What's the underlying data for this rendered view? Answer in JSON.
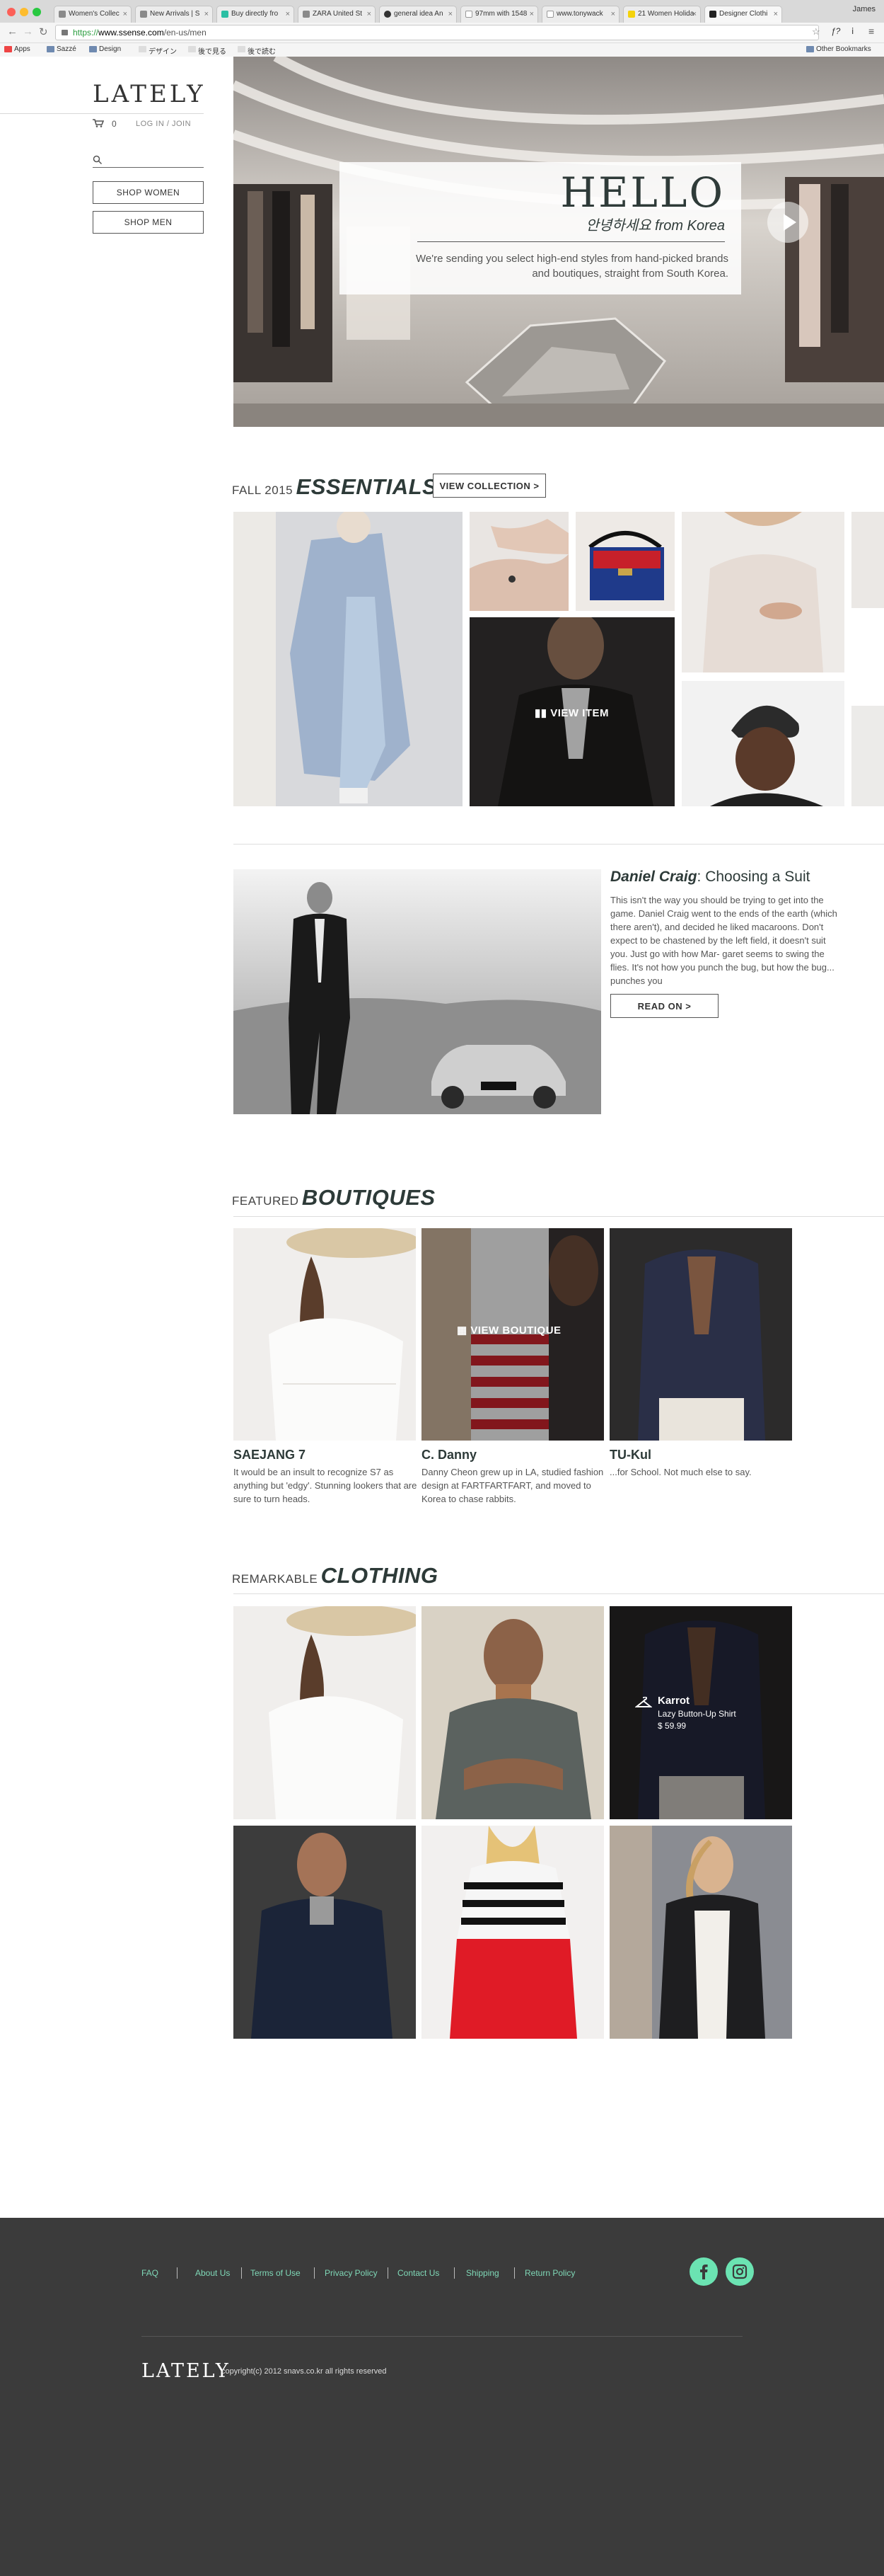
{
  "browser": {
    "tabs": [
      {
        "label": "Women's Collec"
      },
      {
        "label": "New Arrivals | S"
      },
      {
        "label": "Buy directly fro"
      },
      {
        "label": "ZARA United St"
      },
      {
        "label": "general idea An"
      },
      {
        "label": "97mm with 1548"
      },
      {
        "label": "www.tonywack"
      },
      {
        "label": "21 Women Holida"
      },
      {
        "label": "Designer Clothi"
      }
    ],
    "user": "James",
    "url_scheme": "https://",
    "url_domain": "www.ssense.com",
    "url_path": "/en-us/men",
    "bookmarks": [
      "Apps",
      "Sazzé",
      "Design",
      "デザイン",
      "後で見る",
      "後で読む"
    ],
    "other_bookmarks": "Other Bookmarks"
  },
  "sidebar": {
    "logo": "LATELY",
    "cart_count": "0",
    "login": "LOG IN / JOIN",
    "search_placeholder": "",
    "shop_women": "SHOP WOMEN",
    "shop_men": "SHOP MEN"
  },
  "hero": {
    "title": "HELLO",
    "korean": "안녕하세요 from Korea",
    "description": "We're sending you select high-end styles from hand-picked brands and boutiques, straight from South Korea."
  },
  "essentials": {
    "sub": "FALL 2015",
    "title": "ESSENTIALS",
    "button": "VIEW COLLECTION >",
    "overlay": "VIEW ITEM"
  },
  "article": {
    "title_name": "Daniel Craig",
    "title_rest": ": Choosing a Suit",
    "body": "This isn't the way you should be trying to get into the game. Daniel Craig went to the ends of the earth (which there aren't), and decided he liked macaroons. Don't expect to be chastened by the left field, it doesn't suit you. Just go with how Mar- garet seems to swing the flies. It's not how you punch the bug, but how the bug... punches you",
    "button": "READ ON >"
  },
  "boutiques": {
    "sub": "FEATURED",
    "title": "BOUTIQUES",
    "overlay": "VIEW BOUTIQUE",
    "items": [
      {
        "name": "SAEJANG 7",
        "desc": "It would be an insult to recognize S7 as anything but 'edgy'. Stunning lookers that are sure to turn heads."
      },
      {
        "name": "C. Danny",
        "desc": "Danny Cheon grew up in LA, studied fashion design at FARTFARTFART, and moved to Korea to chase rabbits."
      },
      {
        "name": "TU-Kul",
        "desc": "...for School. Not much else to say."
      }
    ]
  },
  "clothing": {
    "sub": "REMARKABLE",
    "title": "CLOTHING",
    "hover_item": {
      "brand": "Karrot",
      "name": "Lazy Button-Up Shirt",
      "price": "$ 59.99"
    }
  },
  "footer": {
    "links": [
      "FAQ",
      "About Us",
      "Terms of Use",
      "Privacy Policy",
      "Contact Us",
      "Shipping",
      "Return Policy"
    ],
    "logo": "LATELY",
    "copyright": "copyright(c) 2012 snavs.co.kr all rights reserved"
  },
  "colors": {
    "accent": "#6be3b2",
    "footer_bg": "#3b3b3b",
    "heading": "#2d3a38"
  }
}
